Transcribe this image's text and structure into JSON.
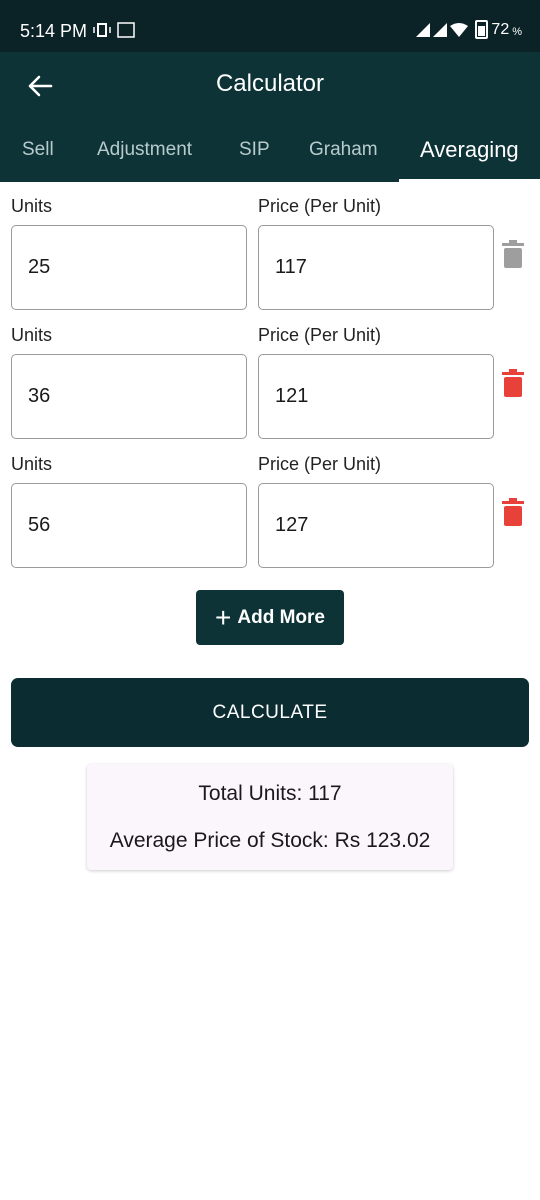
{
  "status_bar": {
    "time": "5:14 PM",
    "battery": "72",
    "battery_unit": "%"
  },
  "app_bar": {
    "title": "Calculator"
  },
  "tabs": [
    {
      "label": "Sell"
    },
    {
      "label": "Adjustment"
    },
    {
      "label": "SIP"
    },
    {
      "label": "Graham"
    },
    {
      "label": "Averaging",
      "active": true
    }
  ],
  "rows": [
    {
      "units_label": "Units",
      "price_label": "Price (Per Unit)",
      "units": "25",
      "price": "117",
      "delete_enabled": false
    },
    {
      "units_label": "Units",
      "price_label": "Price (Per Unit)",
      "units": "36",
      "price": "121",
      "delete_enabled": true
    },
    {
      "units_label": "Units",
      "price_label": "Price (Per Unit)",
      "units": "56",
      "price": "127",
      "delete_enabled": true
    }
  ],
  "add_more_label": "Add More",
  "calculate_label": "CALCULATE",
  "result": {
    "total_units": "Total Units: 117",
    "average_price": "Average Price of Stock: Rs 123.02"
  },
  "colors": {
    "header": "#0d3337",
    "delete_active": "#e8413a",
    "delete_disabled": "#9e9e9e",
    "result_bg": "#fbf5fc"
  }
}
